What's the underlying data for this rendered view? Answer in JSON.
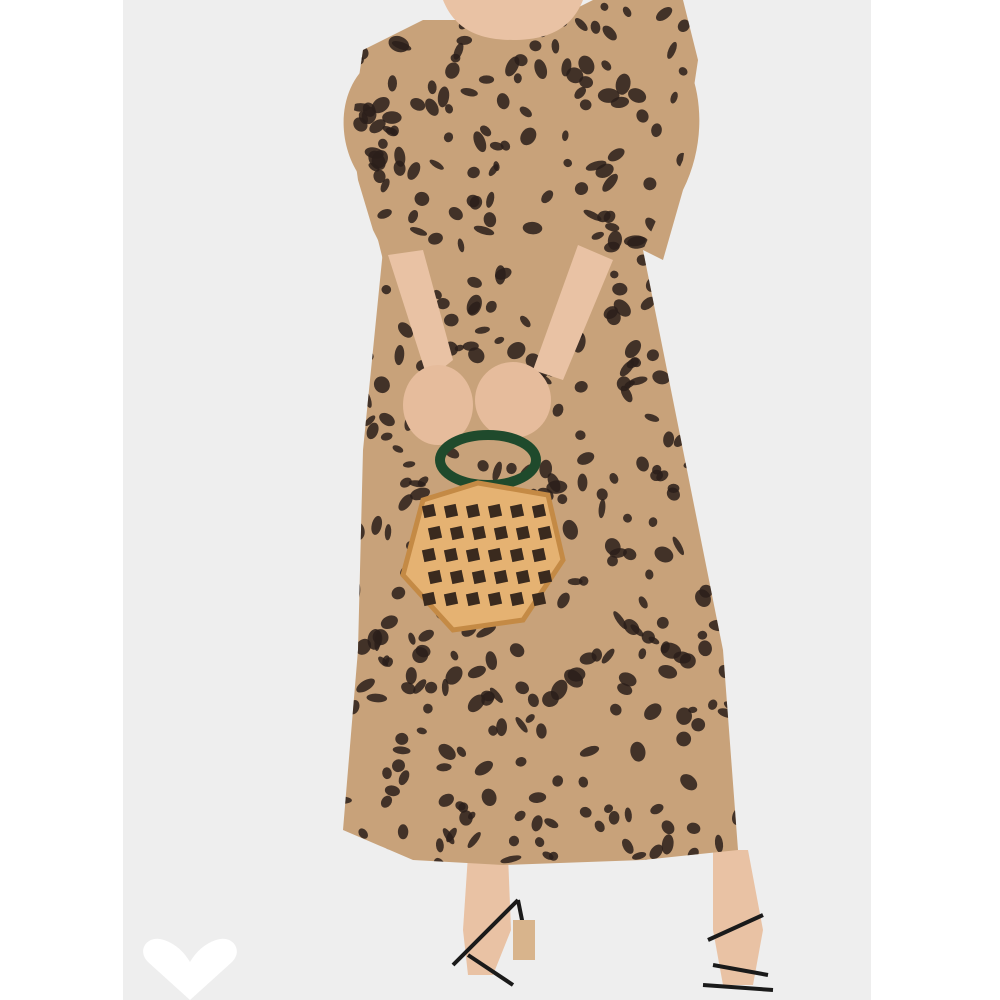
{
  "image": {
    "alt": "",
    "background": "#eeeeee",
    "dress_color": "#c8a27a",
    "spot_color": "#2a1f1a",
    "basket_color": "#e5b272",
    "handle_color": "#1f4a2c",
    "skin_color": "#e9c2a4"
  },
  "favorite": {
    "icon": "heart-icon",
    "color": "#ffffff"
  }
}
